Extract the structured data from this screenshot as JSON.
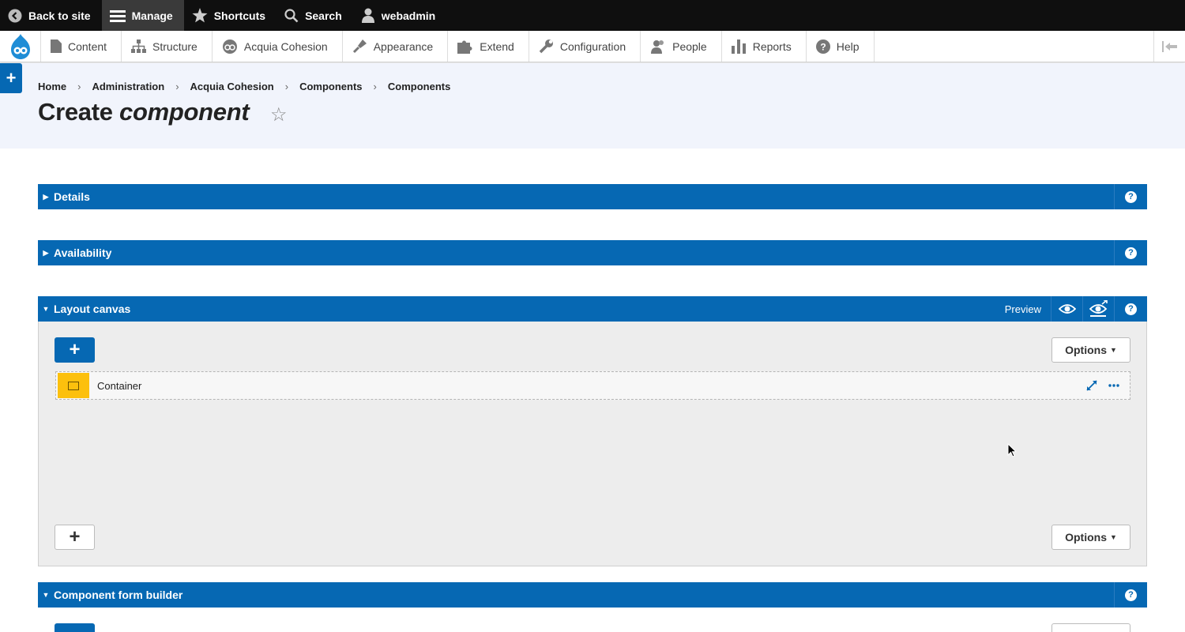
{
  "toolbar": {
    "back_to_site": "Back to site",
    "manage": "Manage",
    "shortcuts": "Shortcuts",
    "search": "Search",
    "user": "webadmin"
  },
  "tray": {
    "items": [
      {
        "label": "Content",
        "icon": "file-icon"
      },
      {
        "label": "Structure",
        "icon": "sitemap-icon"
      },
      {
        "label": "Acquia Cohesion",
        "icon": "cohesion-icon"
      },
      {
        "label": "Appearance",
        "icon": "paintbrush-icon"
      },
      {
        "label": "Extend",
        "icon": "puzzle-icon"
      },
      {
        "label": "Configuration",
        "icon": "wrench-icon"
      },
      {
        "label": "People",
        "icon": "people-icon"
      },
      {
        "label": "Reports",
        "icon": "bar-chart-icon"
      },
      {
        "label": "Help",
        "icon": "help-icon"
      }
    ]
  },
  "breadcrumb": [
    "Home",
    "Administration",
    "Acquia Cohesion",
    "Components",
    "Components"
  ],
  "page": {
    "title_prefix": "Create ",
    "title_emphasis": "component"
  },
  "sections": {
    "details": "Details",
    "availability": "Availability",
    "layout_canvas": "Layout canvas",
    "preview": "Preview",
    "form_builder": "Component form builder"
  },
  "canvas": {
    "add_symbol": "+",
    "options_label": "Options",
    "component_label": "Container"
  },
  "colors": {
    "brand_blue": "#0668b3",
    "container_yellow": "#fcc00d",
    "toolbar_black": "#0f0f0f",
    "header_bg": "#f1f4fc"
  }
}
